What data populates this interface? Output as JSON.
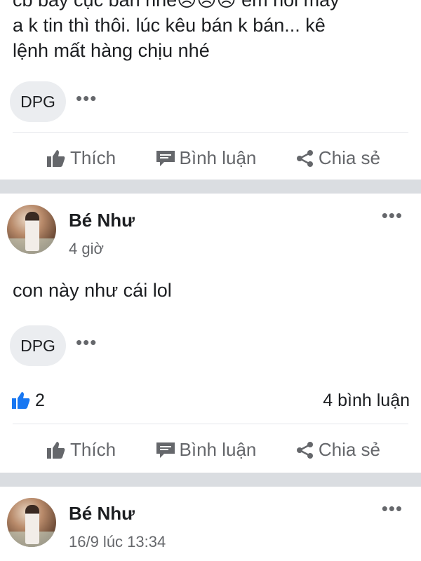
{
  "post1": {
    "text_line1": "cb bay cục bán nhé😠😠😠 em nói mấy",
    "text_line2": "a k tin thì thôi. lúc kêu bán k bán... kê",
    "text_line3": "lệnh mất hàng chịu nhé",
    "tag": "DPG",
    "tag_more": "•••",
    "actions": {
      "like": "Thích",
      "comment": "Bình luận",
      "share": "Chia sẻ"
    }
  },
  "post2": {
    "author": "Bé Như",
    "time": "4 giờ",
    "header_more": "•••",
    "text": "con này như cái lol",
    "tag": "DPG",
    "tag_more": "•••",
    "likes": "2",
    "comments_count": "4 bình luận",
    "actions": {
      "like": "Thích",
      "comment": "Bình luận",
      "share": "Chia sẻ"
    }
  },
  "post3": {
    "author": "Bé Như",
    "time": "16/9 lúc 13:34",
    "header_more": "•••"
  },
  "colors": {
    "accent": "#1877f2",
    "muted": "#65676b",
    "divider": "#dadde1",
    "chip": "#ebedf0"
  },
  "icons": [
    "thumbs-up-icon",
    "comment-icon",
    "share-icon",
    "like-badge-icon",
    "more-icon"
  ]
}
